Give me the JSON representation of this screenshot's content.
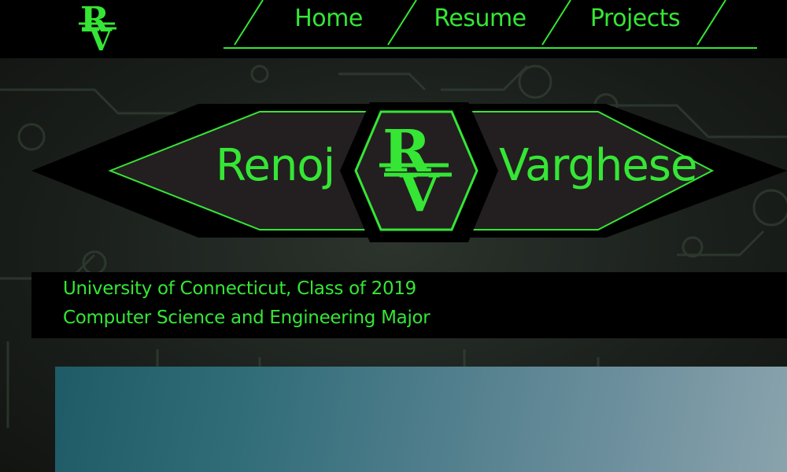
{
  "nav": {
    "logo_icon": "rv-monogram-logo",
    "links": [
      {
        "label": "Home"
      },
      {
        "label": "Resume"
      },
      {
        "label": "Projects"
      }
    ]
  },
  "banner": {
    "first_name": "Renoj",
    "last_name": "Varghese",
    "logo_icon": "rv-monogram-logo"
  },
  "info": {
    "line1": "University of Connecticut, Class of 2019",
    "line2": "Computer Science and Engineering Major"
  },
  "colors": {
    "accent": "#35e635",
    "nav_background": "#000000",
    "banner_fill": "#231f20"
  }
}
